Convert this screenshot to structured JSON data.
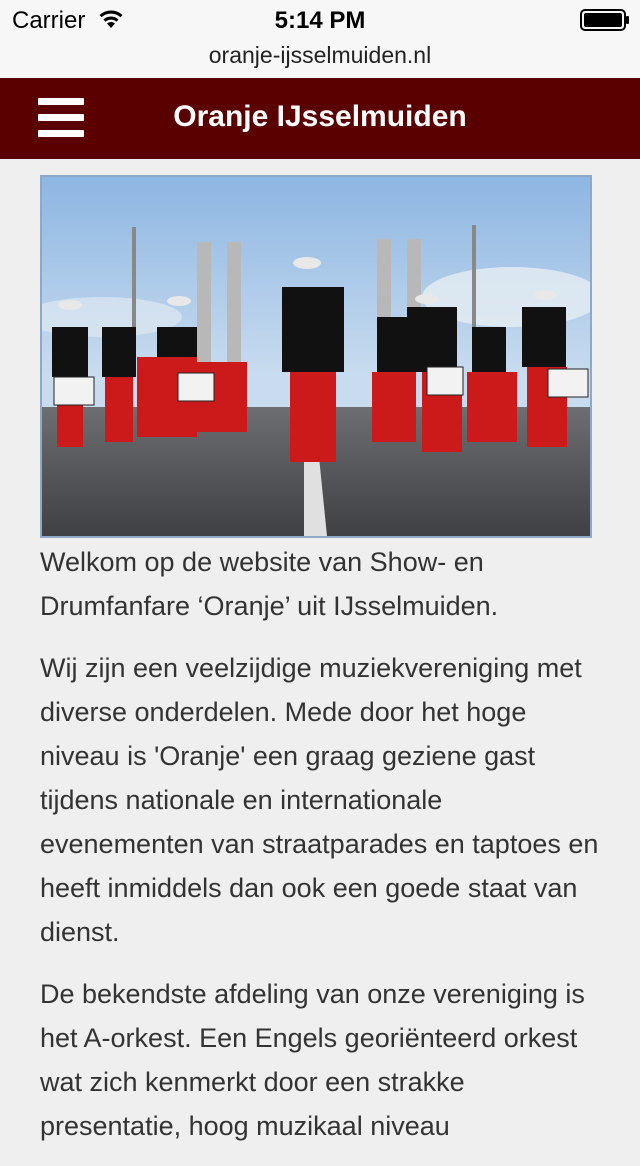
{
  "status_bar": {
    "carrier": "Carrier",
    "time": "5:14 PM",
    "icons": [
      "wifi-icon",
      "battery-icon"
    ]
  },
  "url_bar": {
    "url": "oranje-ijsselmuiden.nl"
  },
  "header": {
    "title": "Oranje IJsselmuiden",
    "menu_icon": "hamburger-menu-icon",
    "background": "#5a0000"
  },
  "hero_image": {
    "subject": "marching band photo"
  },
  "content": {
    "paragraphs": [
      "Welkom op de website van Show- en Drumfanfare ‘Oranje’ uit IJsselmuiden.",
      "Wij zijn een veelzijdige muziekvereniging met diverse onderdelen. Mede door het hoge niveau is 'Oranje' een graag geziene gast tijdens nationale en internationale evenementen van straatparades en taptoes en heeft inmiddels dan ook een goede staat van dienst.",
      "De bekendste afdeling van onze vereniging is het A-orkest. Een Engels georiënteerd orkest wat zich kenmerkt door een strakke presentatie, hoog muzikaal niveau"
    ]
  }
}
